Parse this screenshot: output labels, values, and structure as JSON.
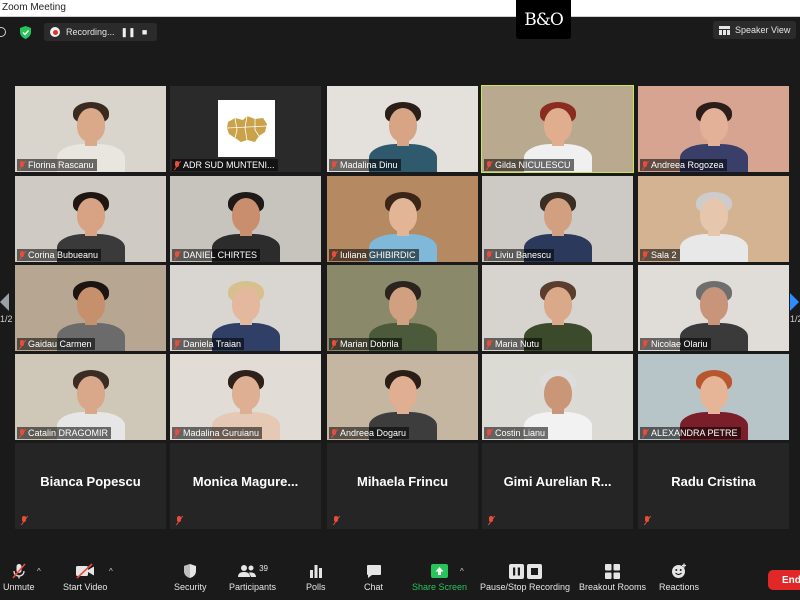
{
  "window": {
    "title": "Zoom Meeting"
  },
  "recording": {
    "label": "Recording...",
    "pause": "❚❚",
    "stop": "■"
  },
  "logo": {
    "text": "B&O"
  },
  "view": {
    "label": "Speaker View"
  },
  "pager": {
    "left": "1/2",
    "right": "1/2"
  },
  "participants": [
    {
      "name": "Florina Rascanu",
      "bg": "#d9d4cc",
      "face": "#d9a98a",
      "hair": "#3b2a20",
      "shirt": "#e9e6e0"
    },
    {
      "name": "ADR SUD MUNTENI...",
      "bg": "#2a2a2a",
      "logo": true
    },
    {
      "name": "Madalina Dinu",
      "bg": "#e4e1dc",
      "face": "#d8a486",
      "hair": "#2b1d17",
      "shirt": "#2f5a6e"
    },
    {
      "name": "Gilda NICULESCU",
      "bg": "#b9a98f",
      "face": "#e0ae8e",
      "hair": "#8a2c1f",
      "shirt": "#f0f0f0",
      "active": true
    },
    {
      "name": "Andreea Rogozea",
      "bg": "#d8a492",
      "face": "#e3b197",
      "hair": "#2c1d18",
      "shirt": "#3a3f6a"
    },
    {
      "name": "Corina Bubueanu",
      "bg": "#cfcac4",
      "face": "#d8a384",
      "hair": "#1f1612",
      "shirt": "#3a3a3a"
    },
    {
      "name": "DANIEL CHIRTES",
      "bg": "#c7c3bd",
      "face": "#c88e6e",
      "hair": "#1e1a17",
      "shirt": "#2c2c2c"
    },
    {
      "name": "Iuliana GHIBIRDIC",
      "bg": "#b58a62",
      "face": "#e3b597",
      "hair": "#3b2418",
      "shirt": "#7fb8d8"
    },
    {
      "name": "Liviu Banescu",
      "bg": "#cdcac6",
      "face": "#d2a081",
      "hair": "#3a2d24",
      "shirt": "#2b3a5c"
    },
    {
      "name": "Sala 2",
      "bg": "#d3b391",
      "face": "#e6c7ad",
      "hair": "#cccccc",
      "shirt": "#e8e8e8"
    },
    {
      "name": "Gaidau Carmen",
      "bg": "#b7a792",
      "face": "#c7906c",
      "hair": "#1b1411",
      "shirt": "#6b6b6b"
    },
    {
      "name": "Daniela Traian",
      "bg": "#d9d6d2",
      "face": "#e4b89c",
      "hair": "#d8c08e",
      "shirt": "#2f3f66"
    },
    {
      "name": "Marian Dobrila",
      "bg": "#8a8a6a",
      "face": "#d0a080",
      "hair": "#2b241e",
      "shirt": "#4a5a3a"
    },
    {
      "name": "Maria Nutu",
      "bg": "#d7d4cf",
      "face": "#d9a98a",
      "hair": "#5a3d2c",
      "shirt": "#3a4a2a"
    },
    {
      "name": "Nicolae Olariu",
      "bg": "#e0ddd8",
      "face": "#c9957a",
      "hair": "#6e6e6e",
      "shirt": "#3a3a3a"
    },
    {
      "name": "Catalin DRAGOMIR",
      "bg": "#cfc8b8",
      "face": "#d9a88a",
      "hair": "#3a2c22",
      "shirt": "#e6e6e6"
    },
    {
      "name": "Madalina Guruianu",
      "bg": "#e1ddd6",
      "face": "#deaf92",
      "hair": "#2e201a",
      "shirt": "#e5c9b5"
    },
    {
      "name": "Andreea Dogaru",
      "bg": "#c4b6a0",
      "face": "#e0ae90",
      "hair": "#2b1e17",
      "shirt": "#3d3d3d"
    },
    {
      "name": "Costin Lianu",
      "bg": "#dcdad5",
      "face": "#c99678",
      "hair": "#dddddd",
      "shirt": "#f2f2f2"
    },
    {
      "name": "ALEXANDRA PETRE",
      "bg": "#b7c4c8",
      "face": "#e6b597",
      "hair": "#b8562e",
      "shirt": "#7a1f2a"
    },
    {
      "name": "Bianca Popescu",
      "textonly": true
    },
    {
      "name": "Monica Magure...",
      "textonly": true
    },
    {
      "name": "Mihaela Frincu",
      "textonly": true
    },
    {
      "name": "Gimi Aurelian R...",
      "textonly": true
    },
    {
      "name": "Radu Cristina",
      "textonly": true
    }
  ],
  "toolbar": {
    "unmute": "Unmute",
    "start_video": "Start Video",
    "security": "Security",
    "participants": "Participants",
    "participants_count": "39",
    "polls": "Polls",
    "chat": "Chat",
    "share_screen": "Share Screen",
    "pause_stop_recording": "Pause/Stop Recording",
    "breakout_rooms": "Breakout Rooms",
    "reactions": "Reactions",
    "end": "End"
  },
  "colors": {
    "accent": "#2d8cff",
    "share": "#27c45a",
    "end": "#e02828",
    "active_border": "#c6e84a",
    "muted": "#e74c3c"
  }
}
